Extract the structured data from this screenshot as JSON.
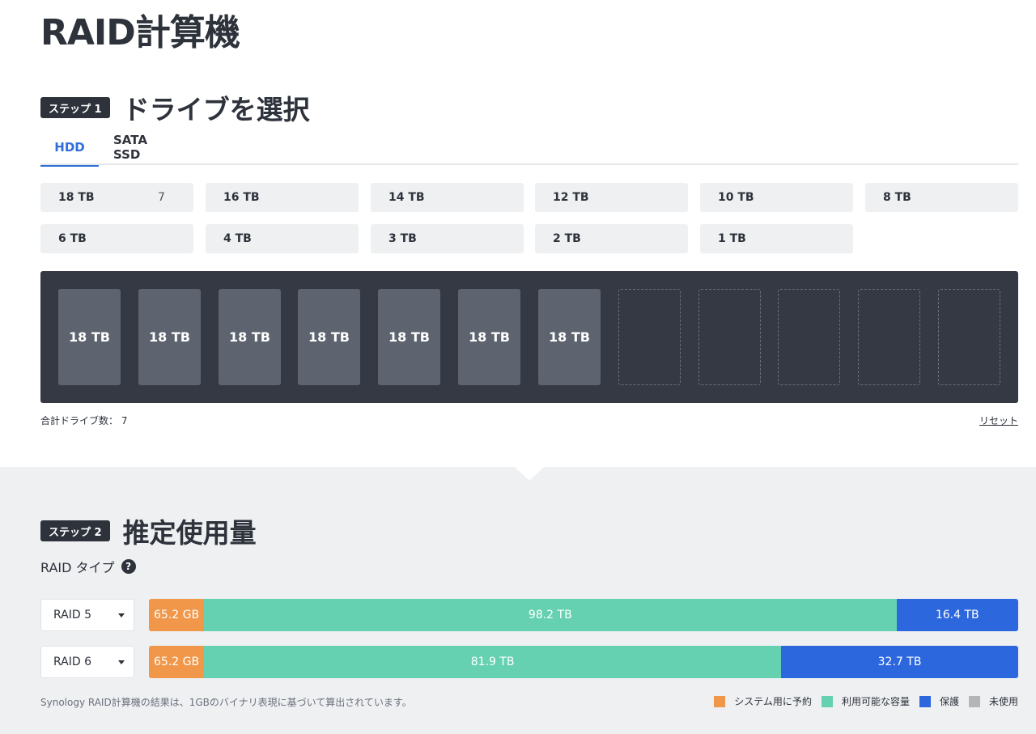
{
  "title": "RAID計算機",
  "step1": {
    "badge": "ステップ 1",
    "heading": "ドライブを選択"
  },
  "tabs": [
    {
      "label": "HDD",
      "active": true
    },
    {
      "label": "SATA SSD",
      "active": false
    }
  ],
  "drive_sizes": [
    {
      "label": "18 TB",
      "count": "7"
    },
    {
      "label": "16 TB"
    },
    {
      "label": "14 TB"
    },
    {
      "label": "12 TB"
    },
    {
      "label": "10 TB"
    },
    {
      "label": "8 TB"
    },
    {
      "label": "6 TB"
    },
    {
      "label": "4 TB"
    },
    {
      "label": "3 TB"
    },
    {
      "label": "2 TB"
    },
    {
      "label": "1 TB"
    }
  ],
  "bays": [
    "18 TB",
    "18 TB",
    "18 TB",
    "18 TB",
    "18 TB",
    "18 TB",
    "18 TB",
    "",
    "",
    "",
    "",
    ""
  ],
  "total_drives": "合計ドライブ数： 7",
  "reset": "リセット",
  "step2": {
    "badge": "ステップ 2",
    "heading": "推定使用量"
  },
  "raid_type_label": "RAID タイプ",
  "help_icon": "?",
  "raid_rows": [
    {
      "select": "RAID 5",
      "segments": [
        {
          "kind": "system",
          "label": "65.2 GB",
          "fraction": 0.0634
        },
        {
          "kind": "usable",
          "label": "98.2 TB",
          "fraction": 0.7965
        },
        {
          "kind": "protect",
          "label": "16.4 TB",
          "fraction": 0.1401
        }
      ]
    },
    {
      "select": "RAID 6",
      "segments": [
        {
          "kind": "system",
          "label": "65.2 GB",
          "fraction": 0.0634
        },
        {
          "kind": "usable",
          "label": "81.9 TB",
          "fraction": 0.6639
        },
        {
          "kind": "protect",
          "label": "32.7 TB",
          "fraction": 0.2727
        }
      ]
    }
  ],
  "footnote": "Synology RAID計算機の結果は、1GBのバイナリ表現に基づいて算出されています。",
  "legend": [
    {
      "label": "システム用に予約",
      "color": "#f0974a"
    },
    {
      "label": "利用可能な容量",
      "color": "#65d1b0"
    },
    {
      "label": "保護",
      "color": "#2d67de"
    },
    {
      "label": "未使用",
      "color": "#b3b5b8"
    }
  ]
}
